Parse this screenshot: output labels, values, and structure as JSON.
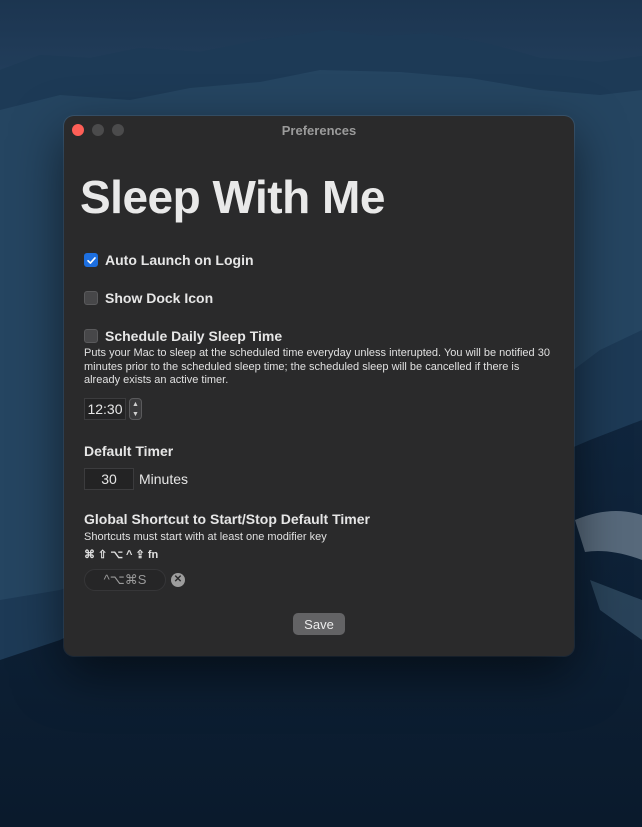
{
  "window": {
    "title": "Preferences"
  },
  "app": {
    "title": "Sleep With Me"
  },
  "options": {
    "auto_launch": {
      "label": "Auto Launch on Login",
      "checked": true
    },
    "show_dock_icon": {
      "label": "Show Dock Icon",
      "checked": false
    },
    "schedule_sleep": {
      "label": "Schedule Daily Sleep Time",
      "checked": false
    }
  },
  "schedule": {
    "description": "Puts your Mac to sleep at the scheduled time everyday unless interupted. You will be notified 30 minutes prior to the scheduled sleep time; the scheduled sleep will be cancelled if there is already exists an active timer.",
    "time": "12:30"
  },
  "default_timer": {
    "heading": "Default Timer",
    "value": "30",
    "unit": "Minutes"
  },
  "shortcut": {
    "heading": "Global Shortcut to Start/Stop Default Timer",
    "hint": "Shortcuts must start with at least one modifier key",
    "modifier_keys": "⌘ ⇧ ⌥ ^ ⇪ fn",
    "value": "^⌥⌘S"
  },
  "actions": {
    "save_label": "Save"
  },
  "colors": {
    "accent": "#1d6fe0",
    "window_bg": "#2a2a2b",
    "close_light": "#fe5f57"
  },
  "icons": {
    "checkbox_checked": "checkmark-icon",
    "clear_shortcut": "clear-x-icon"
  }
}
